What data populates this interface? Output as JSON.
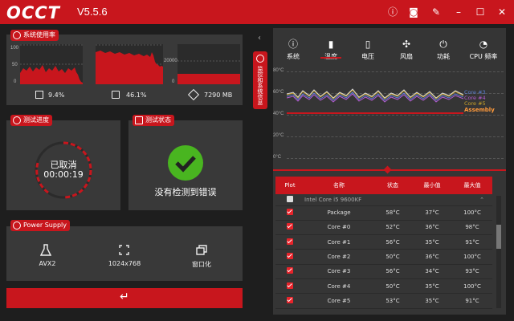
{
  "titlebar": {
    "logo": "OCCT",
    "version": "V5.5.6"
  },
  "system_usage": {
    "title": "系统使用率",
    "cpu": {
      "axis": [
        "100",
        "50",
        "0"
      ],
      "value": "9.4%"
    },
    "mem": {
      "axis": [
        "100",
        "50",
        "0"
      ],
      "value": "46.1%"
    },
    "vram": {
      "axis": [
        "20000",
        "0"
      ],
      "value": "7290 MB"
    }
  },
  "test_progress": {
    "title": "测试进度",
    "status": "已取消",
    "time": "00:00:19"
  },
  "test_status": {
    "title": "测试状态",
    "message_a": "没有",
    "message_b": "检测",
    "message_c": "到",
    "message_d": "错误"
  },
  "power_supply": {
    "title": "Power Supply",
    "items": [
      {
        "label": "AVX2",
        "icon": "flask-icon"
      },
      {
        "label": "1024x768",
        "icon": "fullscreen-icon"
      },
      {
        "label": "窗口化",
        "icon": "window-icon"
      }
    ]
  },
  "side_tab": "监控和系统信息",
  "monitor": {
    "tabs": [
      {
        "label": "系统",
        "icon": "info-icon"
      },
      {
        "label": "温度",
        "icon": "thermometer-icon"
      },
      {
        "label": "电压",
        "icon": "battery-icon"
      },
      {
        "label": "风扇",
        "icon": "fan-icon"
      },
      {
        "label": "功耗",
        "icon": "plug-icon"
      },
      {
        "label": "CPU 频率",
        "icon": "gauge-icon"
      }
    ],
    "graph_axis": [
      "80°C",
      "60°C",
      "40°C",
      "20°C",
      "0°C"
    ],
    "legend": [
      "Core #3",
      "Core #4",
      "Core #5",
      "Assembly"
    ]
  },
  "table": {
    "headers": [
      "Plot",
      "名称",
      "状态",
      "最小值",
      "最大值"
    ],
    "group": "Intel Core i5 9600KF",
    "rows": [
      {
        "name": "Package",
        "status": "58°C",
        "min": "37°C",
        "max": "100°C"
      },
      {
        "name": "Core #0",
        "status": "52°C",
        "min": "36°C",
        "max": "98°C"
      },
      {
        "name": "Core #1",
        "status": "56°C",
        "min": "35°C",
        "max": "91°C"
      },
      {
        "name": "Core #2",
        "status": "50°C",
        "min": "36°C",
        "max": "100°C"
      },
      {
        "name": "Core #3",
        "status": "56°C",
        "min": "34°C",
        "max": "93°C"
      },
      {
        "name": "Core #4",
        "status": "50°C",
        "min": "35°C",
        "max": "100°C"
      },
      {
        "name": "Core #5",
        "status": "53°C",
        "min": "35°C",
        "max": "91°C"
      }
    ]
  },
  "colors": {
    "accent": "#c8161d",
    "panel": "#393939",
    "bg": "#1e1e1e",
    "ok": "#49b520"
  }
}
